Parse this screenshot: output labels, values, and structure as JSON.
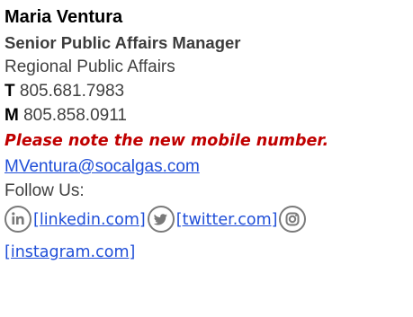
{
  "signature": {
    "name": "Maria Ventura",
    "title": "Senior Public Affairs Manager",
    "department": "Regional Public Affairs",
    "office_phone": {
      "label": "T",
      "number": "805.681.7983"
    },
    "mobile_phone": {
      "label": "M",
      "number": "805.858.0911"
    },
    "notice": "Please note the new mobile number.",
    "email": "MVentura@socalgas.com",
    "follow_label": "Follow Us:",
    "social": [
      {
        "icon": "linkedin-icon",
        "link_text": "[linkedin.com]"
      },
      {
        "icon": "twitter-icon",
        "link_text": "[twitter.com]"
      },
      {
        "icon": "instagram-icon",
        "link_text": "[instagram.com]"
      }
    ]
  },
  "colors": {
    "notice": "#c00000",
    "link": "#1f4ed8",
    "icon": "#7a7a7a"
  }
}
